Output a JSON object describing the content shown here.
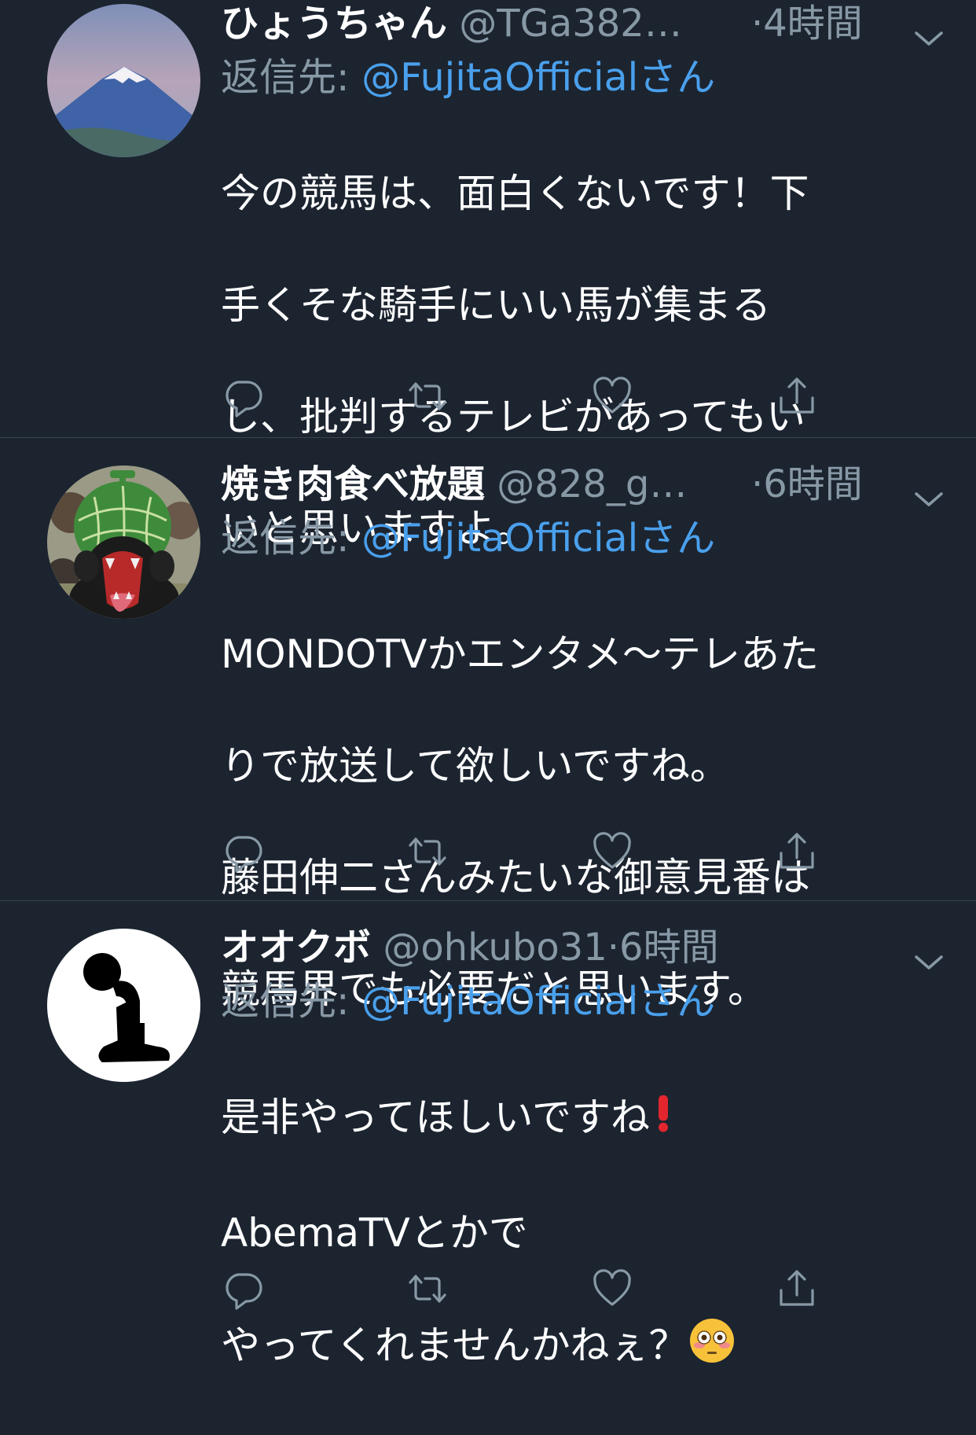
{
  "tweets": [
    {
      "display_name": "ひょうちゃん",
      "handle": "@TGa382…",
      "separator": "·",
      "time": "4時間",
      "reply_label": "返信先: ",
      "reply_handle": "@FujitaOfficialさん",
      "body_lines": [
        "今の競馬は、面白くないです！下",
        "手くそな騎手にいい馬が集まる",
        "し、批判するテレビがあってもい",
        "いと思いますよ。"
      ]
    },
    {
      "display_name": "焼き肉食べ放題",
      "handle": "@828_g…",
      "separator": "·",
      "time": "6時間",
      "reply_label": "返信先: ",
      "reply_handle": "@FujitaOfficialさん",
      "body_lines": [
        "MONDOTVかエンタメ〜テレあた",
        "りで放送して欲しいですね。",
        "藤田伸二さんみたいな御意見番は",
        "競馬界でも必要だと思います。"
      ]
    },
    {
      "display_name": "オオクボ",
      "handle": "@ohkubo31",
      "separator": "·",
      "time": "6時間",
      "reply_label": "返信先: ",
      "reply_handle": "@FujitaOfficialさん",
      "body_lines": [
        "是非やってほしいですね",
        "AbemaTVとかで",
        "やってくれませんかねぇ？"
      ]
    }
  ],
  "icons": {
    "avatar_1": "mount-fuji-avatar",
    "avatar_2": "melon-bear-avatar",
    "avatar_3": "kneeling-figure-avatar",
    "reply": "reply-icon",
    "retweet": "retweet-icon",
    "like": "heart-icon",
    "share": "share-icon",
    "menu": "chevron-down-icon",
    "exclamation": "red-exclamation-emoji",
    "flushed": "flushed-face-emoji"
  },
  "colors": {
    "background": "#1c2430",
    "text": "#ffffff",
    "secondary": "#8899a6",
    "link": "#4aa0ec",
    "divider": "#38444d"
  }
}
